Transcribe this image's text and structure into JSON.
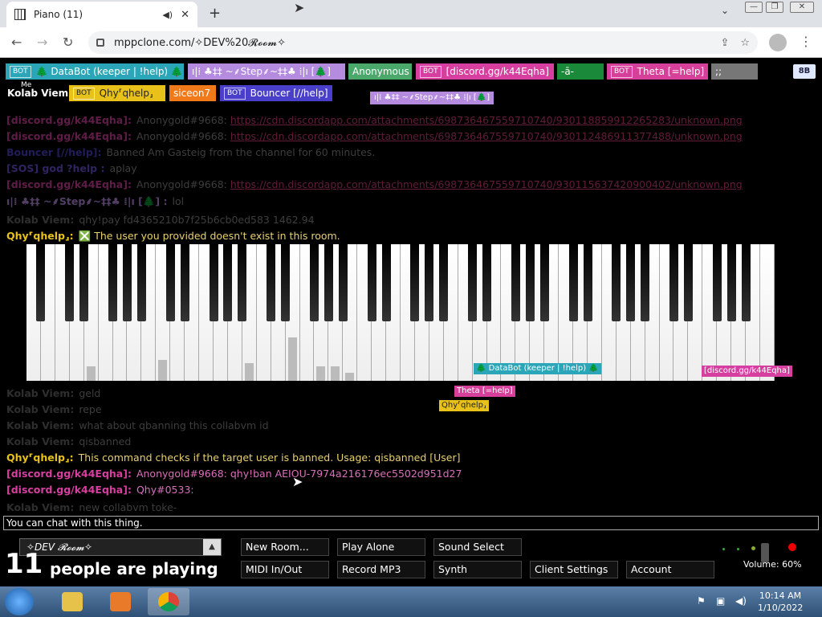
{
  "browser": {
    "tab_title": "Piano (11)",
    "tab_close": "✕",
    "new_tab": "+",
    "url": "mppclone.com/✧DEV%20𝓡𝓸𝓸𝓶✧",
    "window_minimize": "—",
    "window_restore": "❐",
    "window_close": "✕"
  },
  "users": [
    {
      "label": "🌲 DataBot (keeper | !help) 🌲",
      "bot": true,
      "color": "#2aa6b8"
    },
    {
      "label": "ı|⁞ ♣‡‡ ~⸙Step⸙~‡‡♣ ⁞|ı [🌲]",
      "bot": false,
      "color": "#b58be0"
    },
    {
      "label": "Anonymous",
      "bot": false,
      "color": "#4aa86a"
    },
    {
      "label": "[discord.gg/k44Eqha]",
      "bot": true,
      "color": "#d63fa0"
    },
    {
      "label": "-ā-",
      "bot": false,
      "color": "#1a8a3a"
    },
    {
      "label": "Theta [=help]",
      "bot": true,
      "color": "#d63f9a"
    },
    {
      "label": ";;",
      "bot": false,
      "color": "#777"
    },
    {
      "label": "Kolab Viem",
      "bot": false,
      "color": "#000"
    },
    {
      "label": "Qhy⸢qhelp⸥",
      "bot": true,
      "color": "#e8c21a"
    },
    {
      "label": "siceon7",
      "bot": false,
      "color": "#f07a1a"
    },
    {
      "label": "Bouncer [//help]",
      "bot": true,
      "color": "#4a3fc8"
    }
  ],
  "bot_tag": "BOT",
  "me_tag": "Me",
  "badge_8b": "8B",
  "step_tag": "ı|⁞ ♣‡‡ ~⸙Step⸙~‡‡♣ ⁞|ı [🌲]",
  "chat": [
    {
      "who": "[discord.gg/k44Eqha]:",
      "color": "#d63fa0",
      "text": "Anonygold#9668:",
      "link": "https://cdn.discordapp.com/attachments/698736467559710740/930118859912265283/unknown.png",
      "dim": true
    },
    {
      "who": "[discord.gg/k44Eqha]:",
      "color": "#d63fa0",
      "text": "Anonygold#9668:",
      "link": "https://cdn.discordapp.com/attachments/698736467559710740/930112486911377488/unknown.png",
      "dim": true
    },
    {
      "who": "Bouncer [//help]:",
      "color": "#4a3fc8",
      "text": "Banned Am Gasteig from the channel for 60 minutes.",
      "dim": true
    },
    {
      "who": "[SOS] god ?help :",
      "color": "#6a4fd8",
      "text": "aplay",
      "dim": true
    },
    {
      "who": "[discord.gg/k44Eqha]:",
      "color": "#d63fa0",
      "text": "Anonygold#9668:",
      "link": "https://cdn.discordapp.com/attachments/698736467559710740/930115637420900402/unknown.png",
      "dim": true
    },
    {
      "who": "ı|⁞ ♣‡‡ ~⸙Step⸙~‡‡♣ ⁞|ı [🌲] :",
      "color": "#b58be0",
      "text": "lol",
      "dim": true
    },
    {
      "who": "Kolab Viem:",
      "color": "#666",
      "text": "qhy!pay fd4365210b7f25b6cb0ed583 1462.94",
      "dim": true
    },
    {
      "who": "Qhy⸢qhelp⸥:",
      "color": "#e8c21a",
      "text": "❎ The user you provided doesn't exist in this room.",
      "dim": false
    },
    {
      "who": "Kolab Viem:",
      "color": "#666",
      "text": "geld",
      "dim": true
    },
    {
      "who": "Kolab Viem:",
      "color": "#666",
      "text": "repe",
      "dim": true
    },
    {
      "who": "Kolab Viem:",
      "color": "#666",
      "text": "what about qbanning this collabvm id",
      "dim": true
    },
    {
      "who": "Kolab Viem:",
      "color": "#666",
      "text": "qisbanned",
      "dim": true
    },
    {
      "who": "Qhy⸢qhelp⸥:",
      "color": "#e8c21a",
      "text": "This command checks if the target user is banned. Usage: qisbanned [User]",
      "dim": false
    },
    {
      "who": "[discord.gg/k44Eqha]:",
      "color": "#d63fa0",
      "text": "Anonygold#9668: qhy!ban AEIOU-7974a216176ec5502d951d27",
      "dim": false
    },
    {
      "who": "[discord.gg/k44Eqha]:",
      "color": "#d63fa0",
      "text": "Qhy#0533:",
      "dim": false
    },
    {
      "who": "Kolab Viem:",
      "color": "#666",
      "text": "new collabvm toke-",
      "dim": true
    }
  ],
  "cursor_tags": [
    {
      "label": "🌲 DataBot (keeper | !help) 🌲",
      "color": "#2aa6b8"
    },
    {
      "label": "[discord.gg/k44Eqha]",
      "color": "#d63fa0"
    },
    {
      "label": "Theta [=help]",
      "color": "#d63f9a"
    },
    {
      "label": "Qhy⸢qhelp⸥",
      "color": "#e8c21a"
    }
  ],
  "chat_input": "You can chat with this thing.",
  "room": {
    "name": "✧DEV 𝓡𝓸𝓸𝓶✧",
    "arrow": "▲"
  },
  "players": {
    "count": "11",
    "label": "people are playing"
  },
  "buttons": {
    "new_room": "New Room...",
    "play_alone": "Play Alone",
    "sound_select": "Sound Select",
    "midi": "MIDI In/Out",
    "record": "Record MP3",
    "synth": "Synth",
    "client_settings": "Client Settings",
    "account": "Account"
  },
  "volume": {
    "label": "Volume: 60%",
    "level": 0.6
  },
  "taskbar": {
    "time": "10:14 AM",
    "date": "1/10/2022"
  }
}
